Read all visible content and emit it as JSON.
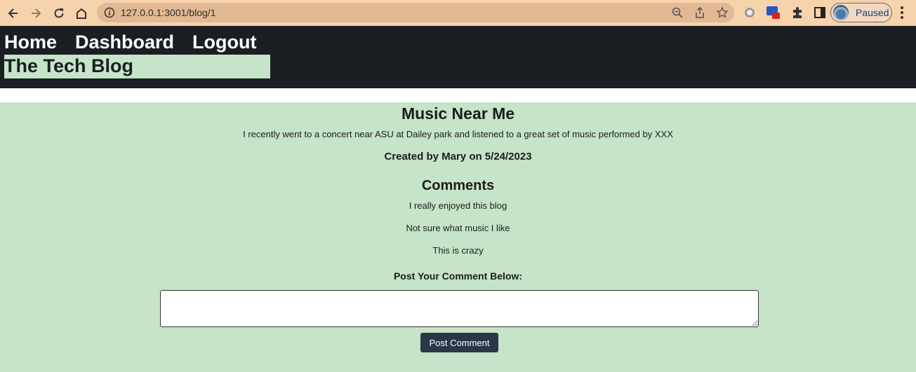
{
  "browser": {
    "url": "127.0.0.1:3001/blog/1",
    "profile_status": "Paused",
    "toolbar_color": "#f6d3ad"
  },
  "nav": {
    "links": [
      {
        "label": "Home"
      },
      {
        "label": "Dashboard"
      },
      {
        "label": "Logout"
      }
    ],
    "brand": "The Tech Blog"
  },
  "post": {
    "title": "Music Near Me",
    "body": "I recently went to a concert near ASU at Dailey park and listened to a great set of music performed by XXX",
    "meta": "Created by Mary on 5/24/2023"
  },
  "comments": {
    "heading": "Comments",
    "items": [
      "I really enjoyed this blog",
      "Not sure what music I like",
      "This is crazy"
    ]
  },
  "form": {
    "label": "Post Your Comment Below:",
    "input_value": "",
    "submit_label": "Post Comment"
  },
  "colors": {
    "header_bg": "#1b1e23",
    "content_bg": "#c6e4c8",
    "button_bg": "#2b3646"
  }
}
